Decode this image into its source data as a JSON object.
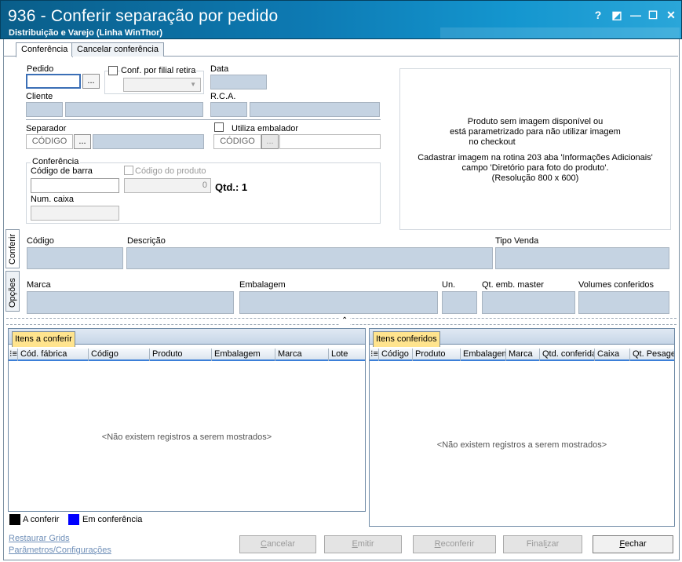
{
  "window": {
    "title": "936 - Conferir separação por pedido",
    "subtitle": "Distribuição e Varejo (Linha WinThor)",
    "help": "?",
    "restore": "◩",
    "minimize": "—",
    "maximize": "☐",
    "close": "✕"
  },
  "tabs": {
    "conferencia": "Conferência",
    "cancelar": "Cancelar conferência"
  },
  "side_tabs": {
    "conferir": "Conferir",
    "opcoes": "Opções"
  },
  "form": {
    "pedido_label": "Pedido",
    "pedido_value": "",
    "lookup": "...",
    "conf_filial_label": "Conf. por filial retira",
    "data_label": "Data",
    "cliente_label": "Cliente",
    "rca_label": "R.C.A.",
    "separador_label": "Separador",
    "separador_placeholder": "CÓDIGO",
    "utiliza_embalador_label": "Utiliza embalador",
    "embalador_placeholder": "CÓDIGO",
    "conferencia_group": "Conferência",
    "codigo_barra_label": "Código de barra",
    "codigo_produto_label": "Código do produto",
    "codigo_produto_value": "0",
    "qtd_label": "Qtd.: 1",
    "num_caixa_label": "Num. caixa"
  },
  "image_box": {
    "line1": "Produto sem imagem disponível ou",
    "line2": "está parametrizado para não utilizar imagem",
    "line3": "no checkout",
    "line4": "Cadastrar imagem na rotina 203 aba 'Informações Adicionais'",
    "line5": "campo 'Diretório para foto do produto'.",
    "line6": "(Resolução 800 x 600)"
  },
  "product": {
    "codigo_label": "Código",
    "descricao_label": "Descrição",
    "tipo_venda_label": "Tipo Venda",
    "marca_label": "Marca",
    "embalagem_label": "Embalagem",
    "un_label": "Un.",
    "qt_emb_master_label": "Qt. emb. master",
    "volumes_conferidos_label": "Volumes conferidos"
  },
  "splitter_icon": "chevron-up-icon",
  "grid_left": {
    "tab": "Itens a conferir",
    "columns": [
      "Cód. fábrica",
      "Código",
      "Produto",
      "Embalagem",
      "Marca",
      "Lote"
    ],
    "empty": "<Não existem registros a serem mostrados>"
  },
  "grid_right": {
    "tab": "Itens conferidos",
    "columns": [
      "Código",
      "Produto",
      "Embalagem",
      "Marca",
      "Qtd. conferida",
      "Caixa",
      "Qt. Pesagem"
    ],
    "empty": "<Não existem registros a serem mostrados>"
  },
  "legend": {
    "a_conferir": "A conferir",
    "a_conferir_color": "#000000",
    "em_conferencia": "Em conferência",
    "em_conferencia_color": "#0000ff"
  },
  "links": {
    "restaurar": "Restaurar Grids",
    "parametros": "Parâmetros/Configurações"
  },
  "buttons": {
    "cancelar_pre": "",
    "cancelar_u": "C",
    "cancelar_post": "ancelar",
    "emitir_pre": "",
    "emitir_u": "E",
    "emitir_post": "mitir",
    "reconferir_pre": "",
    "reconferir_u": "R",
    "reconferir_post": "econferir",
    "finalizar_pre": "Final",
    "finalizar_u": "i",
    "finalizar_post": "zar",
    "fechar_pre": "",
    "fechar_u": "F",
    "fechar_post": "echar"
  },
  "colors": {
    "title_bar": "#0d7ab3",
    "readonly_field": "#c5d3e2",
    "tab_highlight": "#ffe48e",
    "grid_header_line": "#3b7fd8"
  }
}
